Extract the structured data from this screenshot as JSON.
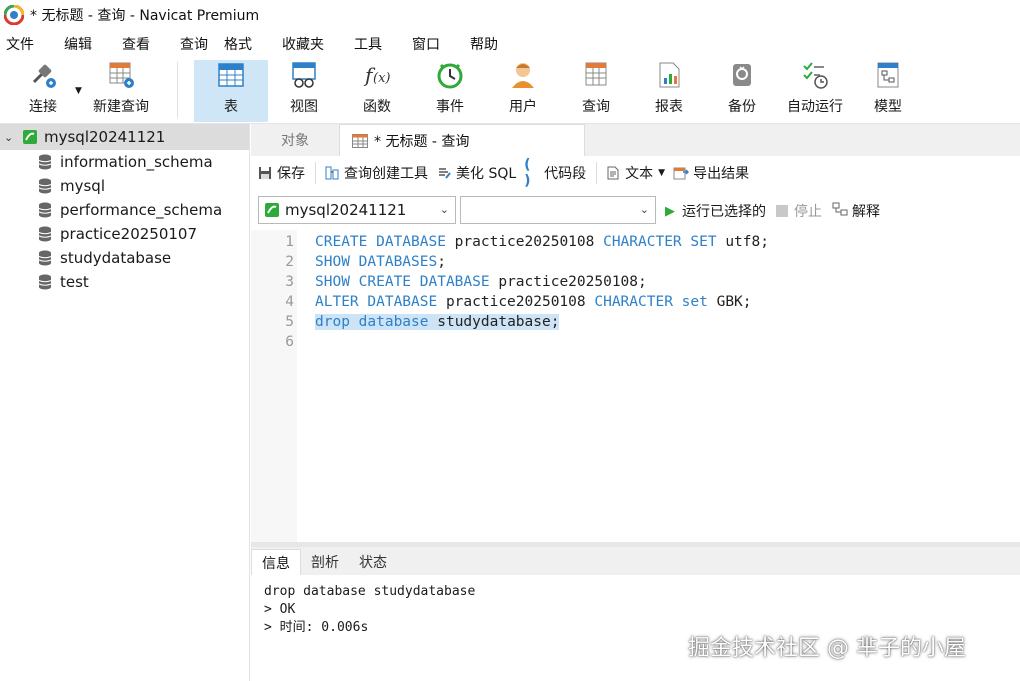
{
  "window": {
    "title": "* 无标题 - 查询 - Navicat Premium"
  },
  "menu": [
    "文件",
    "编辑",
    "查看",
    "查询",
    "格式",
    "收藏夹",
    "工具",
    "窗口",
    "帮助"
  ],
  "ribbon": {
    "connect": "连接",
    "new_query": "新建查询",
    "table": "表",
    "view": "视图",
    "function": "函数",
    "event": "事件",
    "user": "用户",
    "query": "查询",
    "report": "报表",
    "backup": "备份",
    "autorun": "自动运行",
    "model": "模型"
  },
  "sidebar": {
    "connection": "mysql20241121",
    "databases": [
      "information_schema",
      "mysql",
      "performance_schema",
      "practice20250107",
      "studydatabase",
      "test"
    ]
  },
  "tabs": {
    "objects": "对象",
    "active": "* 无标题 - 查询"
  },
  "query_toolbar": {
    "save": "保存",
    "builder": "查询创建工具",
    "beautify": "美化 SQL",
    "snippet": "代码段",
    "text": "文本",
    "export": "导出结果"
  },
  "selectors": {
    "connection_value": "mysql20241121",
    "database_value": ""
  },
  "run": {
    "run_selected": "运行已选择的",
    "stop": "停止",
    "explain": "解释"
  },
  "editor": {
    "lines": [
      {
        "no": "1",
        "tokens": [
          {
            "t": "CREATE DATABASE",
            "k": true
          },
          {
            "t": " practice20250108 ",
            "k": false
          },
          {
            "t": "CHARACTER SET",
            "k": true
          },
          {
            "t": " utf8;",
            "k": false
          }
        ]
      },
      {
        "no": "2",
        "tokens": [
          {
            "t": "SHOW DATABASES",
            "k": true
          },
          {
            "t": ";",
            "k": false
          }
        ]
      },
      {
        "no": "3",
        "tokens": [
          {
            "t": "SHOW CREATE DATABASE",
            "k": true
          },
          {
            "t": " practice20250108;",
            "k": false
          }
        ]
      },
      {
        "no": "4",
        "tokens": [
          {
            "t": "ALTER DATABASE",
            "k": true
          },
          {
            "t": " practice20250108 ",
            "k": false
          },
          {
            "t": "CHARACTER set",
            "k": true
          },
          {
            "t": " GBK;",
            "k": false
          }
        ]
      },
      {
        "no": "5",
        "tokens": [
          {
            "t": "drop database",
            "k": true
          },
          {
            "t": " studydatabase;",
            "k": false
          }
        ],
        "selected": true
      },
      {
        "no": "6",
        "tokens": []
      }
    ]
  },
  "results": {
    "tabs": [
      "信息",
      "剖析",
      "状态"
    ],
    "lines": [
      "drop database studydatabase",
      "> OK",
      "> 时间: 0.006s"
    ]
  },
  "watermark": "掘金技术社区 @ 芈子的小屋",
  "colors": {
    "keyword": "#2f80c8",
    "selection": "#cde4f6",
    "ribbon_active": "#cfe6f7",
    "connection_green": "#2eaa3a"
  }
}
